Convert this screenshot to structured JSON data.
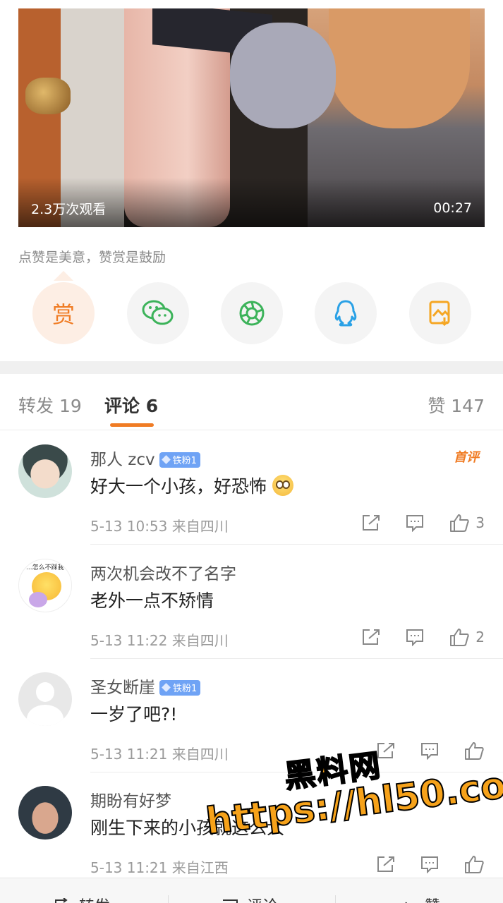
{
  "video": {
    "views": "2.3万次观看",
    "duration": "00:27"
  },
  "reward_tip": "点赞是美意，赞赏是鼓励",
  "share": {
    "reward_label": "赏",
    "items": [
      "wechat-icon",
      "moments-icon",
      "qq-icon",
      "save-image-icon"
    ]
  },
  "tabs": {
    "repost_label": "转发",
    "repost_count": "19",
    "comment_label": "评论",
    "comment_count": "6",
    "like_label": "赞",
    "like_count": "147"
  },
  "comments": [
    {
      "name": "那人 zcv",
      "badge": "铁粉1",
      "first_tag": "首评",
      "text": "好大一个小孩，好恐怖",
      "meta": "5-13 10:53  来自四川",
      "likes": "3"
    },
    {
      "name": "两次机会改不了名字",
      "avatar_caption": "...怎么不踩我",
      "text": "老外一点不矫情",
      "meta": "5-13 11:22  来自四川",
      "likes": "2"
    },
    {
      "name": "圣女断崖",
      "badge": "铁粉1",
      "text": "一岁了吧?!",
      "meta": "5-13 11:21  来自四川",
      "likes": ""
    },
    {
      "name": "期盼有好梦",
      "text": "刚生下来的小孩就这么大",
      "meta": "5-13 11:21  来自江西",
      "likes": ""
    }
  ],
  "watermark": {
    "title": "黑料网",
    "url": "https://hl50.co"
  },
  "bottom_bar": {
    "repost": "转发",
    "comment": "评论",
    "like": "赞"
  },
  "colors": {
    "accent": "#f07c24",
    "badge": "#6fa3f5",
    "wechat": "#3cb35a",
    "qq": "#2aa1e6",
    "save": "#f5a623"
  }
}
